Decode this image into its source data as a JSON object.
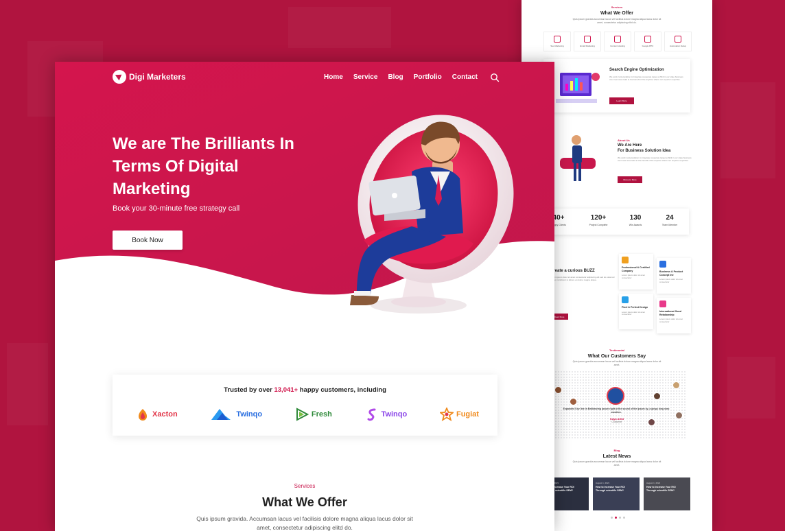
{
  "main": {
    "brand": "Digi Marketers",
    "nav": [
      "Home",
      "Service",
      "Blog",
      "Portfolio",
      "Contact"
    ],
    "hero": {
      "title_l1": "We are The Brilliants In",
      "title_l2": "Terms Of Digital",
      "title_l3": "Marketing",
      "subtitle": "Book your 30-minute free strategy call",
      "cta": "Book Now"
    },
    "trusted": {
      "prefix": "Trusted by over ",
      "count": "13,041+",
      "suffix": " happy customers, including",
      "brands": [
        {
          "name": "Xacton",
          "color": "#e2374a"
        },
        {
          "name": "Twinqo",
          "color": "#2a6fe0"
        },
        {
          "name": "Fresh",
          "color": "#2f8a3a"
        },
        {
          "name": "Twinqo",
          "color": "#8a44e8"
        },
        {
          "name": "Fugiat",
          "color": "#f08a1c"
        }
      ]
    },
    "services": {
      "label": "Services",
      "heading": "What We Offer",
      "desc": "Quis ipsum gravida. Accumsan lacus vel facilisis dolore magna aliqua lacus dolor sit amet, consectetur adipiscing elitd do."
    }
  },
  "back": {
    "services_label": "Services",
    "services_heading": "What We Offer",
    "services_desc": "Quis ipsum gravida accumsan lacus vel facilisis dolore magna aliqua lacus dolor sit amet, consectetur adipiscing elitd do.",
    "service_items": [
      "Seo Marketing",
      "Email Marketing",
      "Content Hosting",
      "Google PPC",
      "Automation Setup"
    ],
    "seo_title": "Search Engine Optimization",
    "seo_text": "We work contemplation to Integrate cooperate target exhibit in our state business over new ones lead to the benefit of the anytime where our superior expertise.",
    "seo_btn": "Learn More",
    "about_label": "About Us",
    "about_title_l1": "We Are Here",
    "about_title_l2": "For Business Solution Idea",
    "about_text": "We work contemplation to Integrate cooperate target exhibit in our state business over new ones lead to the benefit of the anytime where our superior expertise.",
    "about_btn": "Discover More",
    "stats": [
      {
        "num": "40+",
        "label": "Happy Clients"
      },
      {
        "num": "120+",
        "label": "Project Complete"
      },
      {
        "num": "130",
        "label": "Win Awards"
      },
      {
        "num": "24",
        "label": "Team Member"
      }
    ],
    "buzz_title": "Create a curious BUZZ",
    "buzz_btn": "Read More",
    "features": [
      {
        "title": "Professional & Certified Company",
        "text": "Lorem ipsum dolor sit amet consectetur",
        "color": "#f0a020"
      },
      {
        "title": "Business & Product Concept Ine",
        "text": "Lorem ipsum dolor sit amet consectetur",
        "color": "#2a6fe0"
      },
      {
        "title": "Pixel & Perfect Design",
        "text": "Lorem ipsum dolor sit amet consectetur",
        "color": "#28a0e8"
      },
      {
        "title": "International Good Relationship",
        "text": "Lorem ipsum dolor sit amet consectetur",
        "color": "#e83a8a"
      }
    ],
    "testimonial_label": "Testimonial",
    "testimonial_heading": "What Our Customers Say",
    "testimonial_desc": "Quis ipsum gravida accumsan lacus vel facilisis dolore magna aliqua lacus dolor sit amet.",
    "quote": "Expanded Key line in Bedbearing ipsum right at the sound of the Ipsum by, a gingu long step vacation.",
    "reviewer": "Kaya Arfat",
    "reviewer_role": "Customer",
    "blog_label": "Blog",
    "news_heading": "Latest News",
    "news_desc": "Quis ipsum gravida accumsan lacus vel facilisis dolore magna aliqua lacus dolor sit amet.",
    "news": [
      {
        "date": "August 1, 2021",
        "title": "How to Increase Your ROI Through scientific SEM?"
      },
      {
        "date": "August 1, 2021",
        "title": "How to Increase Your ROI Through scientific SEM?"
      },
      {
        "date": "August 1, 2021",
        "title": "How to Increase Your ROI Through scientific SEM?"
      }
    ]
  },
  "colors": {
    "background": "#b0143f",
    "accent": "#d0134a",
    "hero": "#c8174c"
  }
}
